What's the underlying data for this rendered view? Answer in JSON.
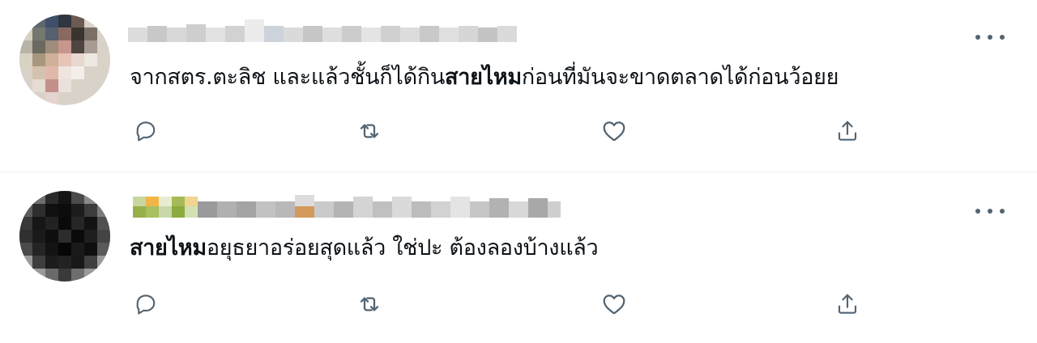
{
  "colors": {
    "icon": "#536471",
    "divider": "#eff3f4",
    "text": "#0f1419"
  },
  "tweets": [
    {
      "text_parts": [
        "จากสตร.ตะลิช และแล้วชั้นก็ได้กิน",
        "สายไหม",
        "ก่อนที่มันจะขาดตลาดได้ก่อนว้อยย"
      ],
      "icons": [
        "reply-icon",
        "retweet-icon",
        "like-icon",
        "share-icon",
        "more-icon"
      ]
    },
    {
      "text_parts": [
        "",
        "สายไหม",
        "อยุธยาอร่อยสุดแล้ว ใช่ปะ ต้องลองบ้างแล้ว"
      ],
      "icons": [
        "reply-icon",
        "retweet-icon",
        "like-icon",
        "share-icon",
        "more-icon"
      ]
    }
  ]
}
